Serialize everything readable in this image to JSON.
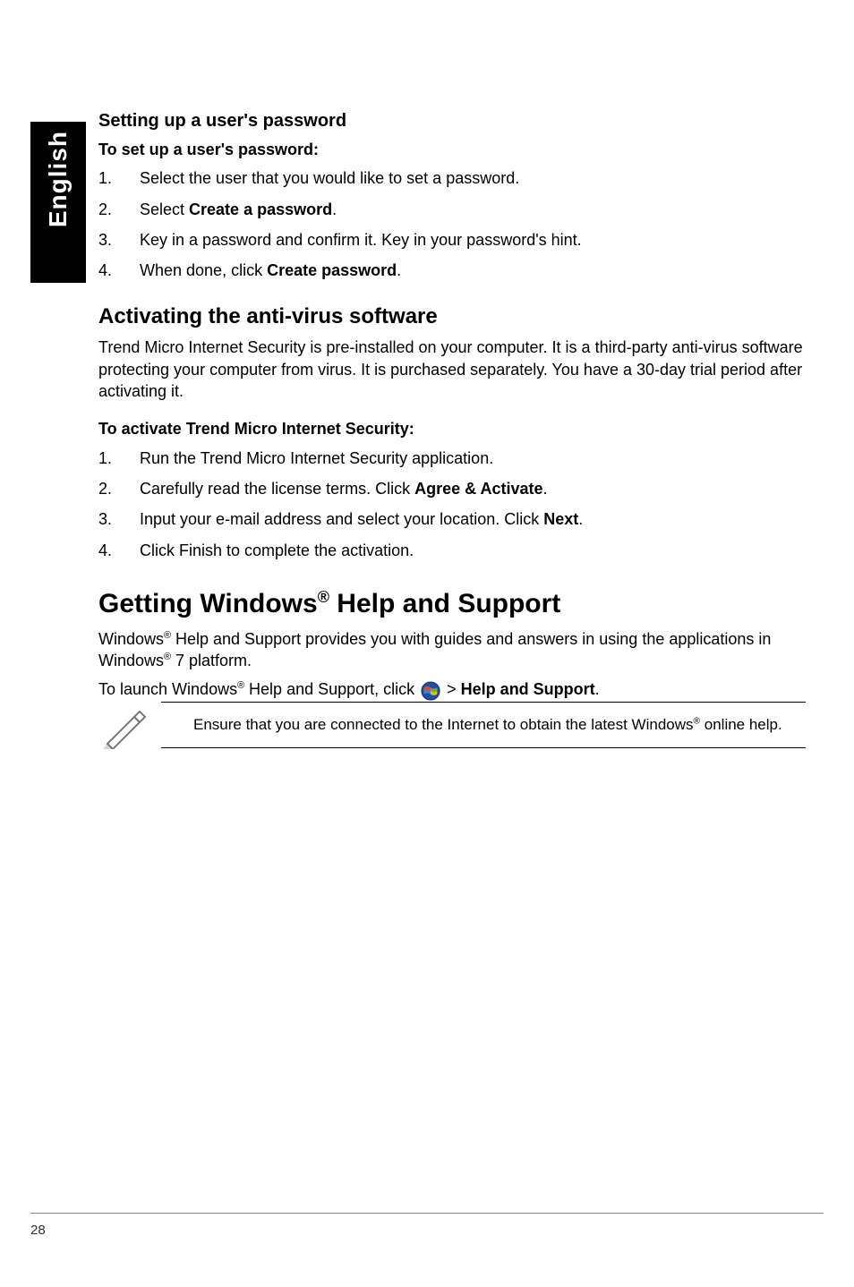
{
  "sideTab": "English",
  "section1": {
    "heading": "Setting up a user's password",
    "lead": "To set up a user's password:",
    "steps": [
      {
        "n": "1.",
        "pre": "Select the user that you would like to set a password."
      },
      {
        "n": "2.",
        "pre": "Select ",
        "bold": "Create a password",
        "post": "."
      },
      {
        "n": "3.",
        "pre": "Key in a password and confirm it. Key in your password's hint."
      },
      {
        "n": "4.",
        "pre": "When done, click ",
        "bold": "Create password",
        "post": "."
      }
    ]
  },
  "section2": {
    "heading": "Activating the anti-virus software",
    "body": "Trend Micro Internet Security is pre-installed on your computer. It is a third-party anti-virus software protecting your computer from virus. It is purchased separately. You have a 30-day trial period after activating it.",
    "lead": "To activate Trend Micro Internet Security:",
    "steps": [
      {
        "n": "1.",
        "pre": "Run the Trend Micro Internet Security application."
      },
      {
        "n": "2.",
        "pre": "Carefully read the license terms. Click ",
        "bold": "Agree & Activate",
        "post": "."
      },
      {
        "n": "3.",
        "pre": "Input your e-mail address and select your location. Click ",
        "bold": "Next",
        "post": "."
      },
      {
        "n": "4.",
        "pre": "Click Finish to complete the activation."
      }
    ]
  },
  "section3": {
    "heading_pre": "Getting Windows",
    "heading_sup": "®",
    "heading_post": " Help and Support",
    "body_pre": "Windows",
    "body_sup": "®",
    "body_mid": " Help and Support provides you with guides and answers in using the applications in Windows",
    "body_sup2": "®",
    "body_post": " 7 platform.",
    "launch_pre": "To launch Windows",
    "launch_sup": "®",
    "launch_mid": " Help and Support, click ",
    "launch_gt": " > ",
    "launch_bold": "Help and Support",
    "launch_post": ".",
    "note_pre": "Ensure that you are connected to the Internet to obtain the latest Windows",
    "note_sup": "®",
    "note_post": " online help."
  },
  "pageNumber": "28"
}
